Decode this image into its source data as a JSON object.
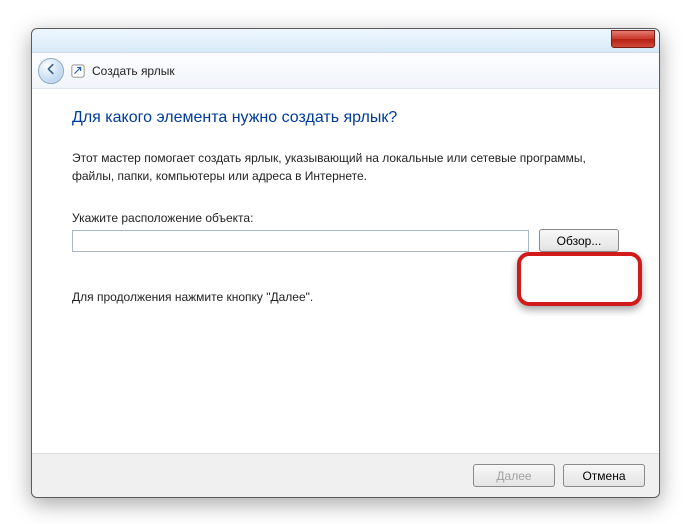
{
  "titlebar": {
    "close_icon": "✕"
  },
  "header": {
    "title": "Создать ярлык"
  },
  "content": {
    "heading": "Для какого элемента нужно создать ярлык?",
    "description": "Этот мастер помогает создать ярлык, указывающий на локальные или сетевые программы, файлы, папки, компьютеры или адреса в Интернете.",
    "location_label": "Укажите расположение объекта:",
    "location_value": "",
    "browse_label": "Обзор...",
    "continue_hint": "Для продолжения нажмите кнопку \"Далее\"."
  },
  "footer": {
    "next_label": "Далее",
    "cancel_label": "Отмена"
  }
}
